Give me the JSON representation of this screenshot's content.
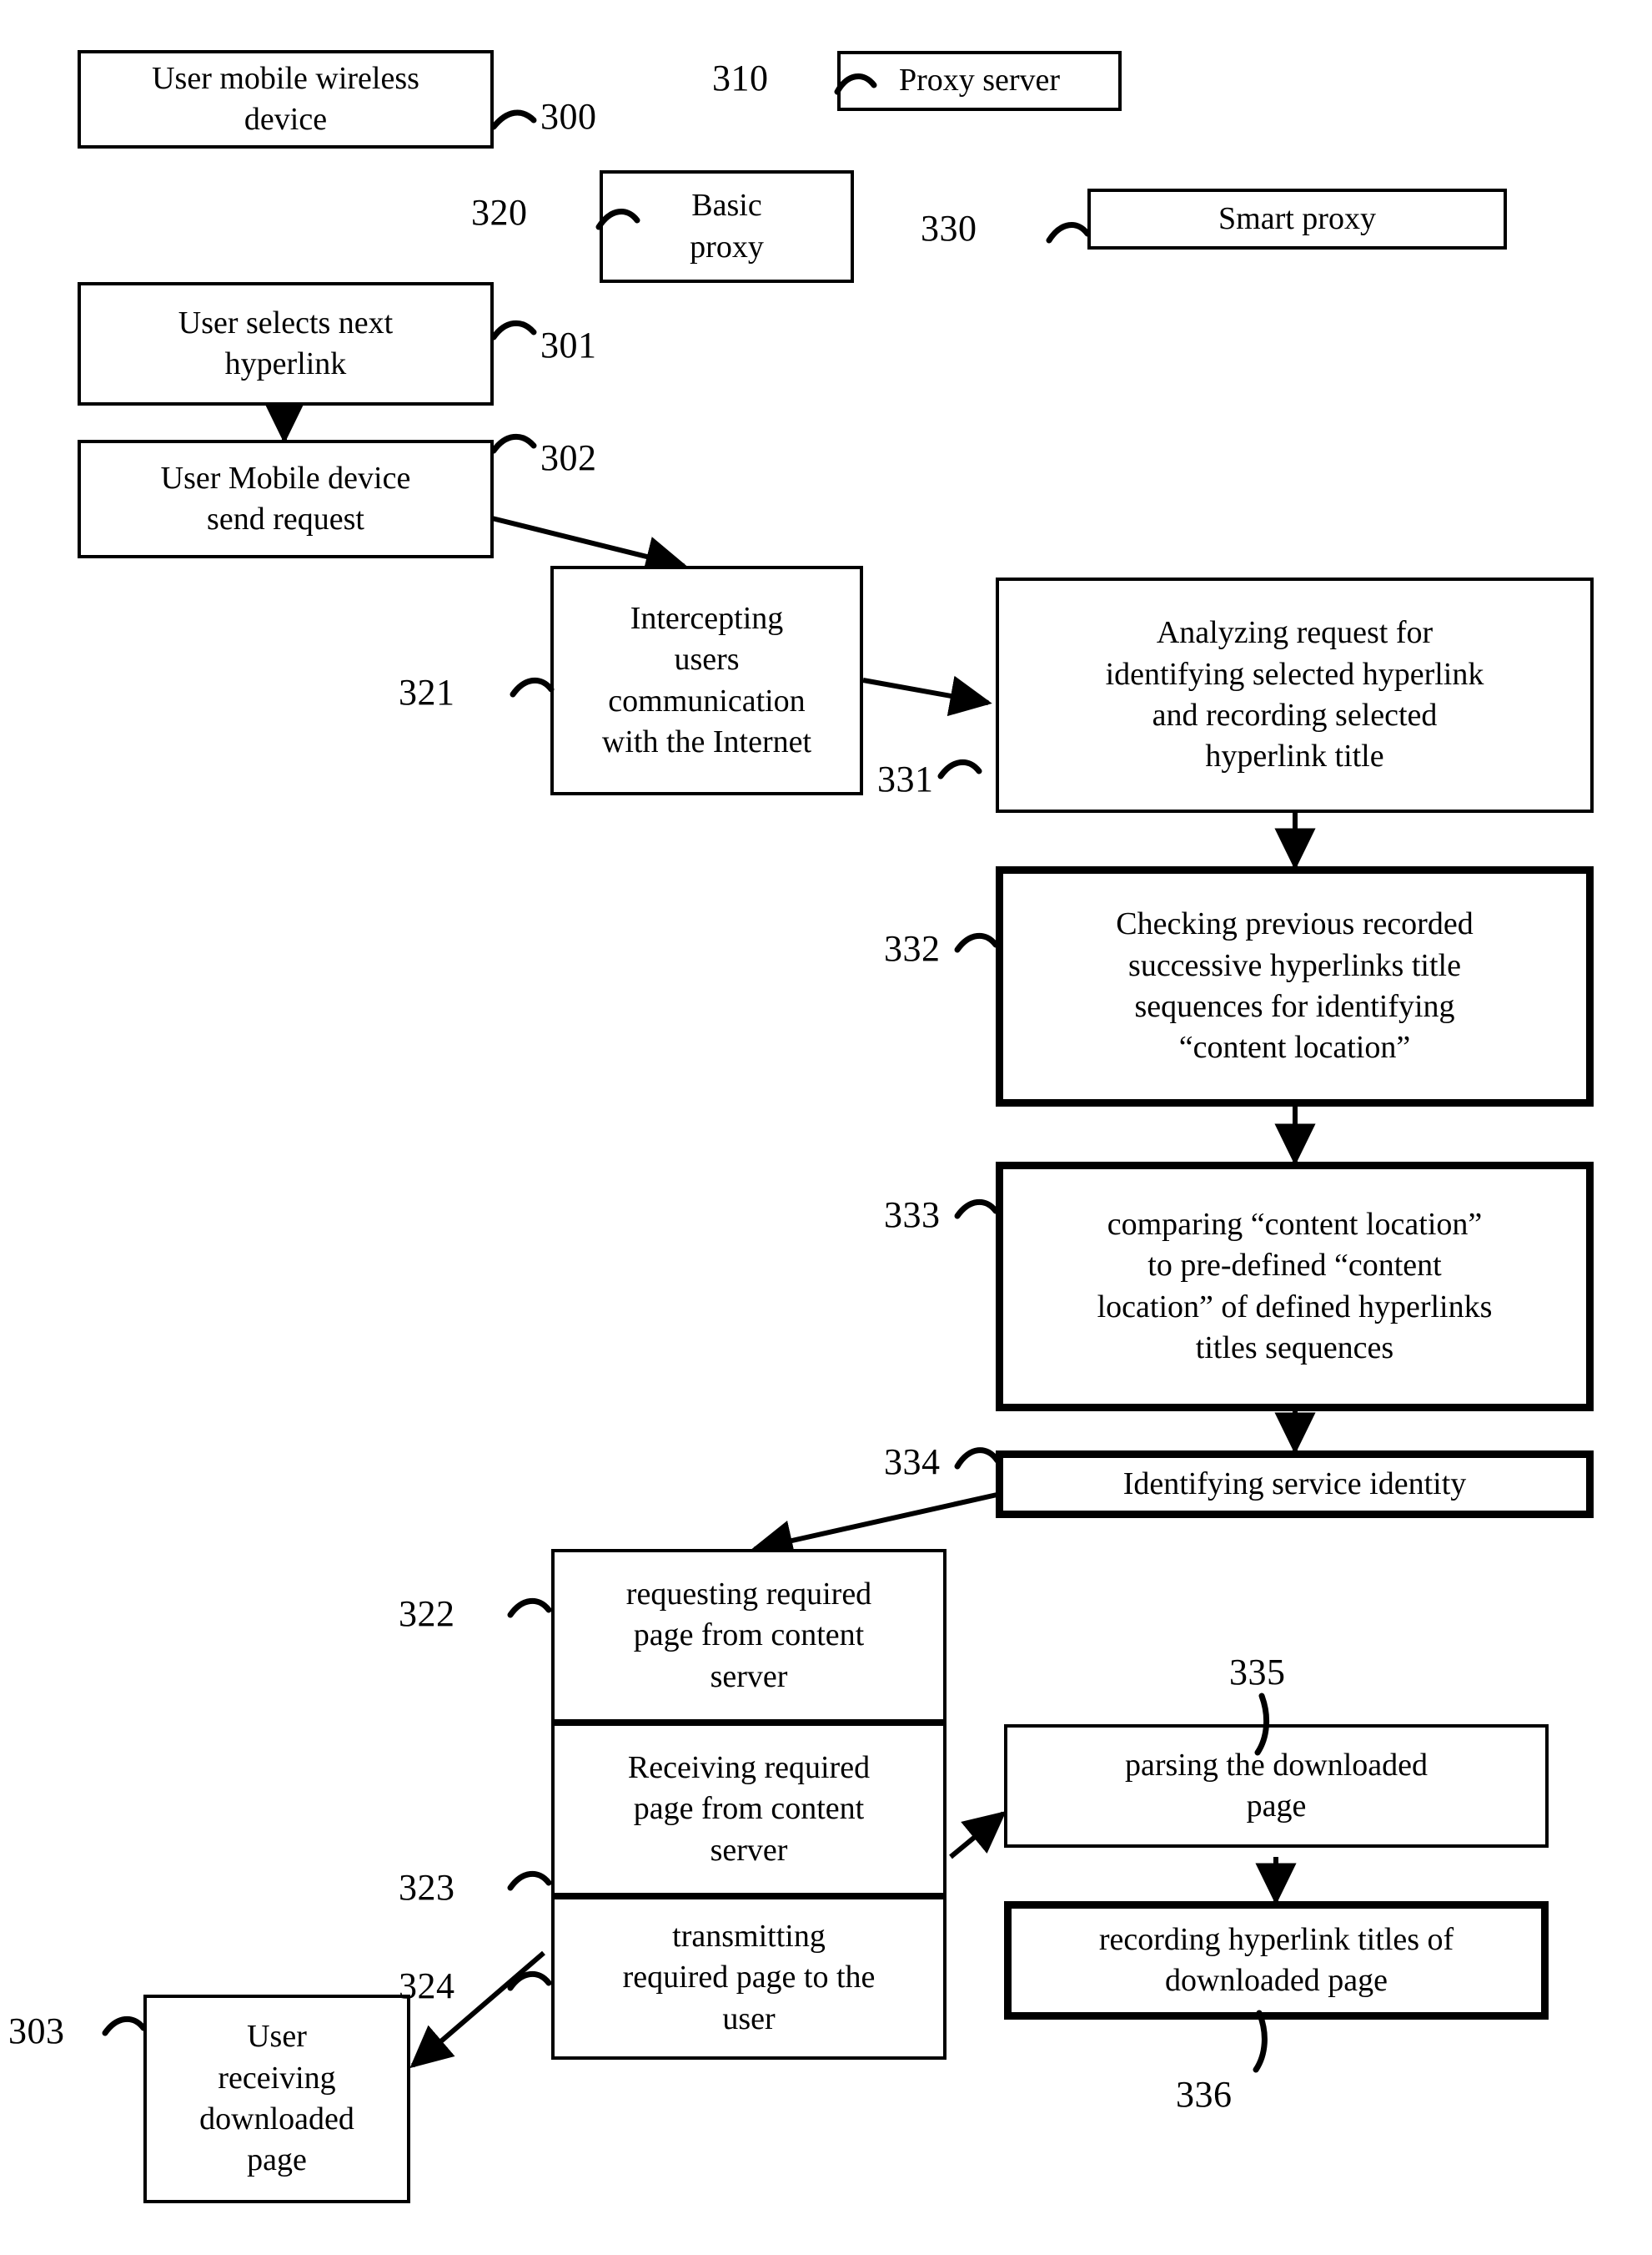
{
  "figure": {
    "type": "patent-flow-diagram",
    "background_color": "#ffffff",
    "line_color": "#000000"
  },
  "blocks": {
    "b300": {
      "label": "User mobile wireless\ndevice",
      "ref": "300",
      "emphasis": "normal"
    },
    "b310": {
      "label": "Proxy  server",
      "ref": "310",
      "emphasis": "normal"
    },
    "b320": {
      "label": "Basic\nproxy",
      "ref": "320",
      "emphasis": "normal"
    },
    "b330": {
      "label": "Smart proxy",
      "ref": "330",
      "emphasis": "normal"
    },
    "b301": {
      "label": "User selects next\nhyperlink",
      "ref": "301",
      "emphasis": "normal"
    },
    "b302": {
      "label": "User Mobile device\nsend request",
      "ref": "302",
      "emphasis": "normal"
    },
    "b321": {
      "label": "Intercepting\nusers\ncommunication\nwith the Internet",
      "ref": "321",
      "emphasis": "normal"
    },
    "b331": {
      "label": "Analyzing request for\nidentifying selected hyperlink\nand recording selected\nhyperlink title",
      "ref": "331",
      "emphasis": "normal"
    },
    "b332": {
      "label": "Checking previous recorded\nsuccessive hyperlinks title\nsequences for identifying\n“content location”",
      "ref": "332",
      "emphasis": "bold"
    },
    "b333": {
      "label": "comparing “content location”\nto pre-defined “content\nlocation” of defined hyperlinks\ntitles sequences",
      "ref": "333",
      "emphasis": "bold"
    },
    "b334": {
      "label": "Identifying service identity",
      "ref": "334",
      "emphasis": "bold"
    },
    "b322": {
      "label": "requesting required\npage from content\nserver",
      "ref": "322",
      "emphasis": "normal"
    },
    "b323": {
      "label": "Receiving required\npage from content\nserver",
      "ref": "323",
      "emphasis": "normal"
    },
    "b324": {
      "label": "transmitting\nrequired page to the\nuser",
      "ref": "324",
      "emphasis": "normal"
    },
    "b303": {
      "label": "User\nreceiving\ndownloaded\npage",
      "ref": "303",
      "emphasis": "normal"
    },
    "b335": {
      "label": "parsing the downloaded\npage",
      "ref": "335",
      "emphasis": "normal"
    },
    "b336": {
      "label": "recording hyperlink titles of\ndownloaded page",
      "ref": "336",
      "emphasis": "bold"
    }
  },
  "connections": [
    {
      "from": "b301",
      "to": "b302",
      "style": "vertical-arrow"
    },
    {
      "from": "b302",
      "to": "b321",
      "style": "diagonal-arrow"
    },
    {
      "from": "b321",
      "to": "b331",
      "style": "diagonal-arrow"
    },
    {
      "from": "b331",
      "to": "b332",
      "style": "vertical-arrow"
    },
    {
      "from": "b332",
      "to": "b333",
      "style": "vertical-arrow"
    },
    {
      "from": "b333",
      "to": "b334",
      "style": "vertical-arrow"
    },
    {
      "from": "b334",
      "to": "b322",
      "style": "diagonal-arrow"
    },
    {
      "from": "b322",
      "to": "b323",
      "style": "vertical-arrow"
    },
    {
      "from": "b323",
      "to": "b324",
      "style": "vertical-arrow"
    },
    {
      "from": "b323",
      "to": "b335",
      "style": "diagonal-arrow"
    },
    {
      "from": "b335",
      "to": "b336",
      "style": "vertical-arrow"
    },
    {
      "from": "b324",
      "to": "b303",
      "style": "diagonal-arrow"
    }
  ]
}
